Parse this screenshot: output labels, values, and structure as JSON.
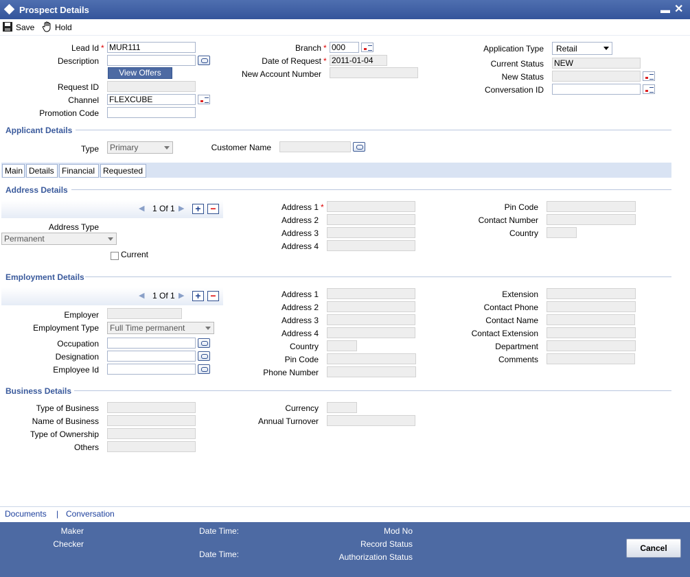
{
  "window": {
    "title": "Prospect Details",
    "minimize_glyph": "▬",
    "close_glyph": "✕"
  },
  "toolbar": {
    "save_label": "Save",
    "hold_label": "Hold",
    "save_icon": "floppy-disk-icon",
    "hold_icon": "hand-icon"
  },
  "header": {
    "lead_id_label": "Lead Id",
    "lead_id_value": "MUR111",
    "description_label": "Description",
    "description_value": "",
    "view_offers_label": "View Offers",
    "request_id_label": "Request ID",
    "request_id_value": "",
    "channel_label": "Channel",
    "channel_value": "FLEXCUBE",
    "promotion_code_label": "Promotion Code",
    "promotion_code_value": "",
    "branch_label": "Branch",
    "branch_value": "000",
    "date_of_request_label": "Date of Request",
    "date_of_request_value": "2011-01-04",
    "new_account_number_label": "New Account Number",
    "new_account_number_value": "",
    "application_type_label": "Application Type",
    "application_type_value": "Retail",
    "current_status_label": "Current Status",
    "current_status_value": "NEW",
    "new_status_label": "New Status",
    "new_status_value": "",
    "conversation_id_label": "Conversation ID",
    "conversation_id_value": "",
    "required_marker": "*"
  },
  "applicant": {
    "title": "Applicant Details",
    "type_label": "Type",
    "type_value": "Primary",
    "customer_name_label": "Customer Name",
    "customer_name_value": ""
  },
  "tabs": [
    {
      "label": "Main"
    },
    {
      "label": "Details"
    },
    {
      "label": "Financial"
    },
    {
      "label": "Requested"
    }
  ],
  "address": {
    "title": "Address Details",
    "pager": "1 Of 1",
    "address_type_label": "Address Type",
    "address_type_value": "Permanent",
    "current_label": "Current",
    "address1_label": "Address 1",
    "address2_label": "Address 2",
    "address3_label": "Address 3",
    "address4_label": "Address 4",
    "pin_code_label": "Pin Code",
    "contact_number_label": "Contact Number",
    "country_label": "Country"
  },
  "employment": {
    "title": "Employment Details",
    "pager": "1 Of 1",
    "employer_label": "Employer",
    "employment_type_label": "Employment Type",
    "employment_type_value": "Full Time permanent",
    "occupation_label": "Occupation",
    "designation_label": "Designation",
    "employee_id_label": "Employee Id",
    "address1_label": "Address 1",
    "address2_label": "Address 2",
    "address3_label": "Address 3",
    "address4_label": "Address 4",
    "country_label": "Country",
    "pin_code_label": "Pin Code",
    "phone_number_label": "Phone Number",
    "extension_label": "Extension",
    "contact_phone_label": "Contact Phone",
    "contact_name_label": "Contact Name",
    "contact_extension_label": "Contact Extension",
    "department_label": "Department",
    "comments_label": "Comments"
  },
  "business": {
    "title": "Business Details",
    "type_label": "Type of Business",
    "name_label": "Name of Business",
    "ownership_label": "Type of Ownership",
    "others_label": "Others",
    "currency_label": "Currency",
    "annual_turnover_label": "Annual Turnover"
  },
  "footer": {
    "documents_link": "Documents",
    "separator": "|",
    "conversation_link": "Conversation",
    "maker_label": "Maker",
    "checker_label": "Checker",
    "date_time_label": "Date Time:",
    "mod_no_label": "Mod No",
    "record_status_label": "Record Status",
    "authorization_status_label": "Authorization Status",
    "cancel_label": "Cancel"
  },
  "colors": {
    "title_bar": "#34559b",
    "status_bar": "#4d6aa3",
    "section_title": "#3a5a9c",
    "required": "#dd0000"
  }
}
